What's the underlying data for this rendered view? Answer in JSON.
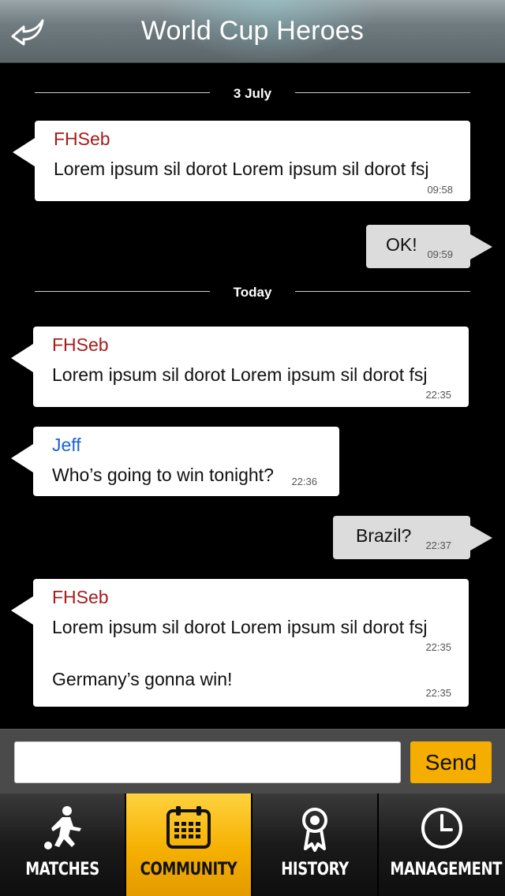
{
  "header": {
    "title": "World Cup Heroes",
    "back_icon": "back-arrow-icon"
  },
  "chat": {
    "dividers": [
      {
        "label": "3 July"
      },
      {
        "label": "Today"
      }
    ],
    "messages": [
      {
        "direction": "incoming",
        "sender": "FHSeb",
        "sender_color": "#a51d1d",
        "text": "Lorem ipsum sil dorot Lorem ipsum sil dorot fsj",
        "time": "09:58"
      },
      {
        "direction": "outgoing",
        "text": "OK!",
        "time": "09:59"
      },
      {
        "direction": "incoming",
        "sender": "FHSeb",
        "sender_color": "#a51d1d",
        "text": "Lorem ipsum sil dorot Lorem ipsum sil dorot fsj",
        "time": "22:35"
      },
      {
        "direction": "incoming",
        "sender": "Jeff",
        "sender_color": "#1a62d6",
        "text": "Who’s going to win tonight?",
        "time": "22:36"
      },
      {
        "direction": "outgoing",
        "text": "Brazil?",
        "time": "22:37"
      },
      {
        "direction": "incoming",
        "sender": "FHSeb",
        "sender_color": "#a51d1d",
        "text": "Lorem ipsum sil dorot Lorem ipsum sil dorot fsj",
        "time": "22:35",
        "text2": "Germany’s gonna win!",
        "time2": "22:35"
      }
    ]
  },
  "composer": {
    "input_value": "",
    "send_label": "Send",
    "send_color": "#f5ad00"
  },
  "tabs": [
    {
      "label": "MATCHES",
      "icon": "soccer-player-icon",
      "active": false
    },
    {
      "label": "COMMUNITY",
      "icon": "calendar-icon",
      "active": true
    },
    {
      "label": "HISTORY",
      "icon": "award-ribbon-icon",
      "active": false
    },
    {
      "label": "MANAGEMENT",
      "icon": "clock-icon",
      "active": false
    }
  ]
}
